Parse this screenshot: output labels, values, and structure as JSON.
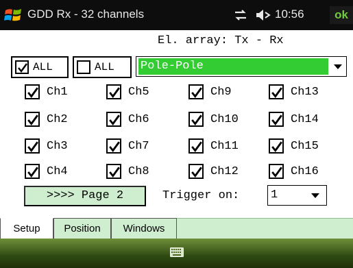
{
  "titlebar": {
    "app_title": "GDD Rx - 32 channels",
    "clock": "10:56",
    "ok_label": "ok",
    "icons": [
      "windows-logo-icon",
      "connectivity-icon",
      "volume-icon"
    ]
  },
  "el_array_label": "El. array: Tx - Rx",
  "all_checks": [
    {
      "label": "ALL",
      "checked": true
    },
    {
      "label": "ALL",
      "checked": false
    }
  ],
  "array_combo": {
    "value": "Pole-Pole"
  },
  "channels": {
    "col1": [
      "Ch1",
      "Ch2",
      "Ch3",
      "Ch4"
    ],
    "col2": [
      "Ch5",
      "Ch6",
      "Ch7",
      "Ch8"
    ],
    "col3": [
      "Ch9",
      "Ch10",
      "Ch11",
      "Ch12"
    ],
    "col4": [
      "Ch13",
      "Ch14",
      "Ch15",
      "Ch16"
    ],
    "all_checked": true
  },
  "page_button": ">>>> Page 2",
  "trigger": {
    "label": "Trigger on:",
    "value": "1"
  },
  "tabs": [
    {
      "label": "Setup",
      "active": true
    },
    {
      "label": "Position",
      "active": false
    },
    {
      "label": "Windows",
      "active": false
    }
  ],
  "colors": {
    "accent_green": "#33cc33",
    "panel_green": "#cfeecf",
    "ok_green": "#6fcf3a"
  }
}
